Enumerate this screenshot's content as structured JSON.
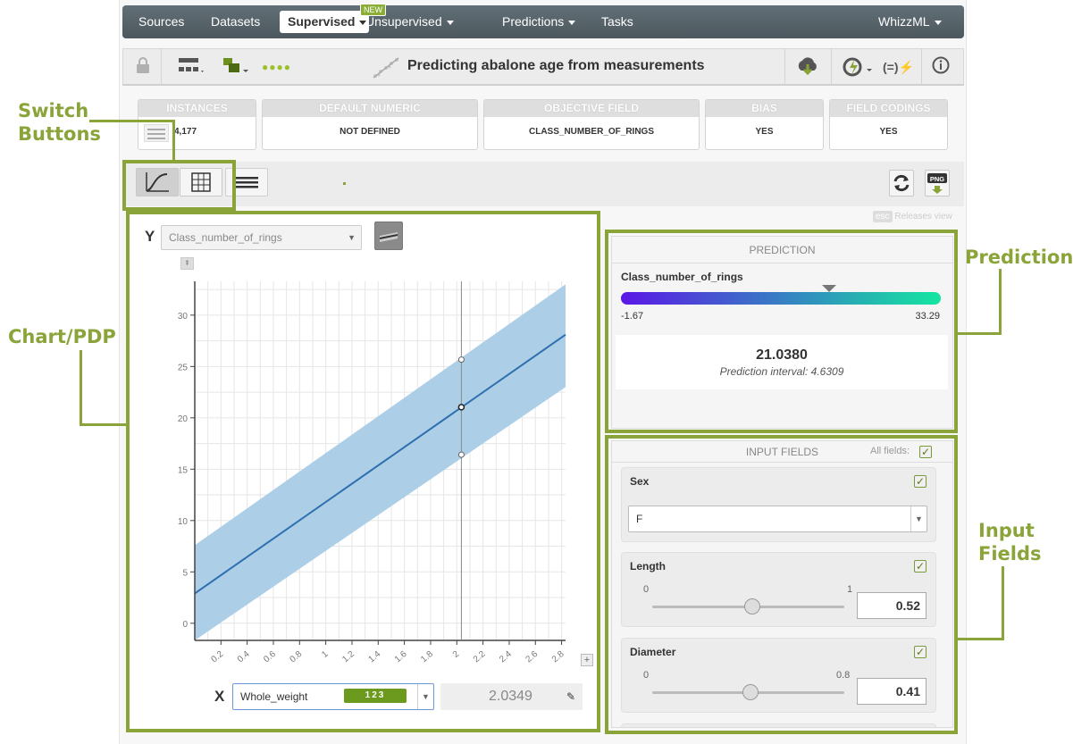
{
  "nav": {
    "items": [
      "Sources",
      "Datasets",
      "Unsupervised",
      "Predictions",
      "Tasks"
    ],
    "active": "Supervised",
    "new_badge": "NEW",
    "user_menu": "WhizzML"
  },
  "toolbar": {
    "title": "Predicting abalone age from measurements"
  },
  "cards": [
    {
      "header": "INSTANCES",
      "value": "4,177"
    },
    {
      "header": "DEFAULT NUMERIC",
      "value": "NOT DEFINED"
    },
    {
      "header": "OBJECTIVE FIELD",
      "value": "CLASS_NUMBER_OF_RINGS"
    },
    {
      "header": "BIAS",
      "value": "YES"
    },
    {
      "header": "FIELD CODINGS",
      "value": "YES"
    }
  ],
  "releases_view": {
    "key": "esc",
    "label": "Releases view"
  },
  "chart": {
    "y_label": "Y",
    "y_field": "Class_number_of_rings",
    "x_label": "X",
    "x_field": "Whole_weight",
    "x_field_type": "123",
    "x_value": "2.0349"
  },
  "chart_data": {
    "type": "line",
    "title": "",
    "xlabel": "",
    "ylabel": "",
    "x_ticks": [
      "0.2",
      "0.4",
      "0.6",
      "0.8",
      "1",
      "1.2",
      "1.4",
      "1.6",
      "1.8",
      "2",
      "2.2",
      "2.4",
      "2.6",
      "2.8"
    ],
    "y_ticks": [
      "0",
      "5",
      "10",
      "15",
      "20",
      "25",
      "30"
    ],
    "xlim": [
      0,
      2.83
    ],
    "ylim": [
      -1.67,
      33.29
    ],
    "x": [
      0,
      2.83
    ],
    "series": [
      {
        "values": [
          2.9,
          28.1
        ]
      },
      {
        "values": [
          7.6,
          33.0
        ]
      },
      {
        "values": [
          -1.67,
          23.0
        ]
      }
    ],
    "marker": {
      "x": 2.0349,
      "y": 21.038,
      "upper": 25.669,
      "lower": 16.407
    },
    "grid": true
  },
  "prediction": {
    "header": "PREDICTION",
    "field": "Class_number_of_rings",
    "min": "-1.67",
    "max": "33.29",
    "value": "21.0380",
    "interval": "Prediction interval: 4.6309",
    "value_fraction": 0.65,
    "gradient": [
      "#5b17e6",
      "#14e6a0"
    ]
  },
  "inputs": {
    "header": "INPUT FIELDS",
    "all_fields": "All fields:",
    "fields": [
      {
        "name": "Sex",
        "value": "F"
      },
      {
        "name": "Length",
        "min": "0",
        "max": "1",
        "value": "0.52",
        "fraction": 0.52
      },
      {
        "name": "Diameter",
        "min": "0",
        "max": "0.8",
        "value": "0.41",
        "fraction": 0.5125
      }
    ]
  },
  "callouts": {
    "switch": "Switch\nButtons",
    "chart": "Chart/PDP",
    "prediction": "Prediction",
    "input": "Input\nFields"
  },
  "colors": {
    "accent": "#8aa43a",
    "band": "#a8cce6",
    "line": "#2e6fb0"
  }
}
